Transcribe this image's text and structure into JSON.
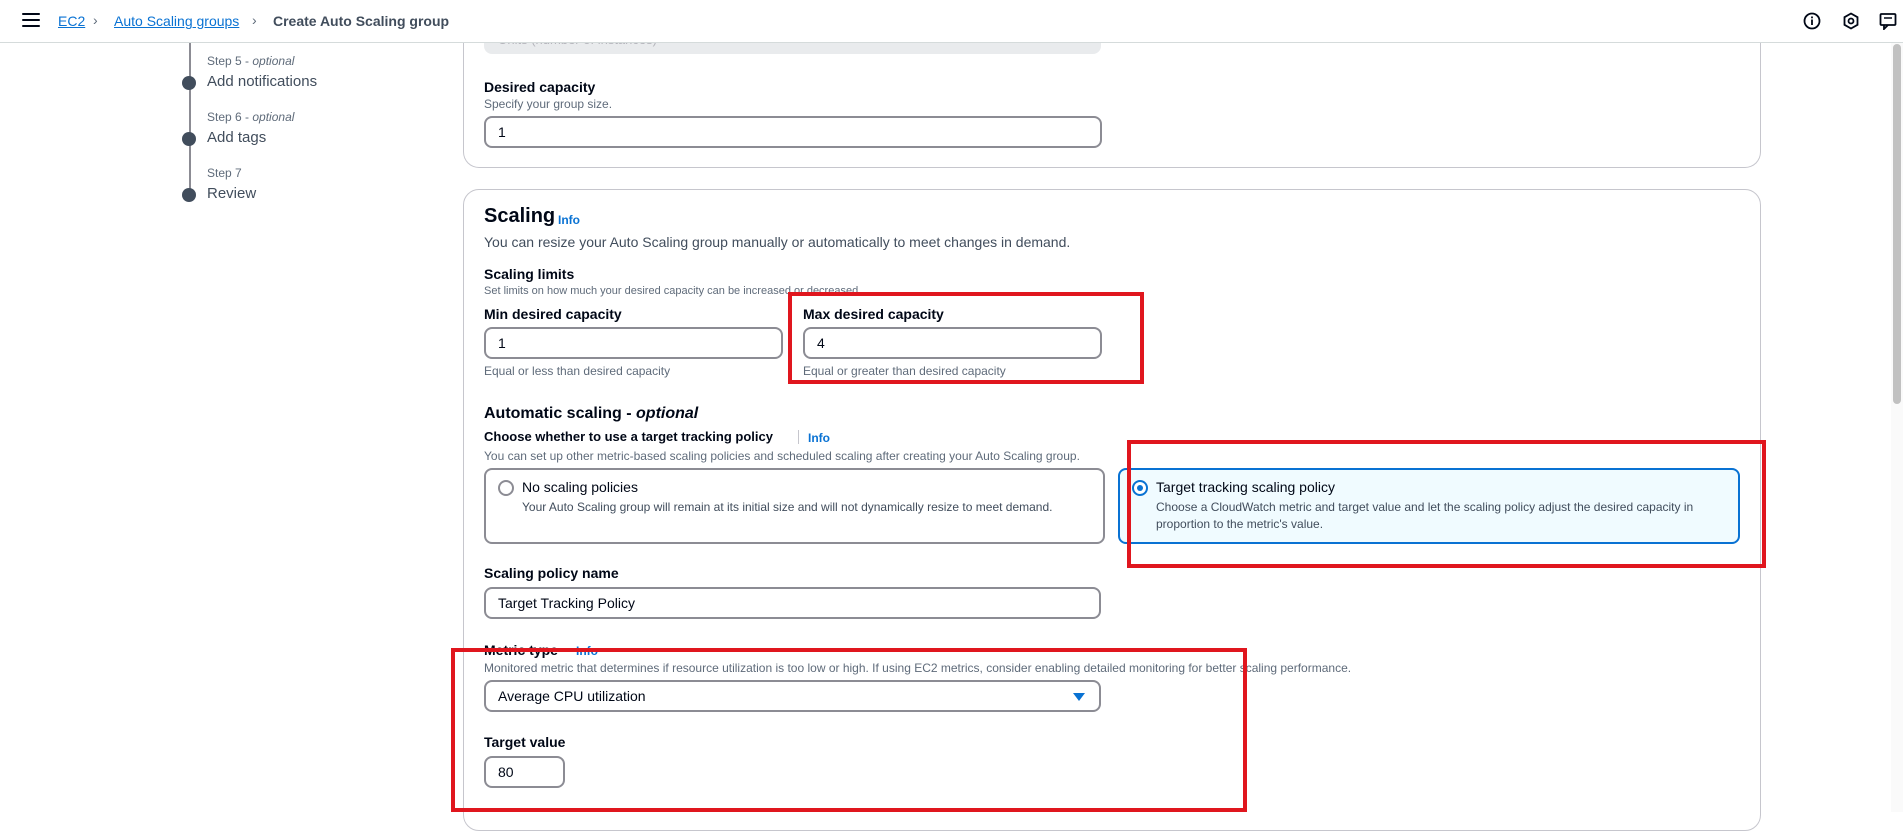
{
  "header": {
    "breadcrumbs": [
      "EC2",
      "Auto Scaling groups",
      "Create Auto Scaling group"
    ],
    "icons": [
      "menu-icon",
      "info-circle-icon",
      "settings-hex-icon",
      "feedback-icon"
    ]
  },
  "steps": [
    {
      "number": "Step 5",
      "suffix": "optional",
      "name": "Add notifications"
    },
    {
      "number": "Step 6",
      "suffix": "optional",
      "name": "Add tags"
    },
    {
      "number": "Step 7",
      "suffix": "",
      "name": "Review"
    }
  ],
  "capacity": {
    "disabled_placeholder": "Units (number of instances)",
    "desired_label": "Desired capacity",
    "desired_desc": "Specify your group size.",
    "desired_value": "1"
  },
  "scaling": {
    "title": "Scaling",
    "info": "Info",
    "desc": "You can resize your Auto Scaling group manually or automatically to meet changes in demand.",
    "limits_label": "Scaling limits",
    "limits_desc": "Set limits on how much your desired capacity can be increased or decreased.",
    "min_label": "Min desired capacity",
    "min_value": "1",
    "min_hint": "Equal or less than desired capacity",
    "max_label": "Max desired capacity",
    "max_value": "4",
    "max_hint": "Equal or greater than desired capacity"
  },
  "auto": {
    "title": "Automatic scaling - ",
    "title_optional": "optional",
    "choose_label": "Choose whether to use a target tracking policy",
    "info": "Info",
    "choose_desc": "You can set up other metric-based scaling policies and scheduled scaling after creating your Auto Scaling group.",
    "option_none_title": "No scaling policies",
    "option_none_desc": "Your Auto Scaling group will remain at its initial size and will not dynamically resize to meet demand.",
    "option_target_title": "Target tracking scaling policy",
    "option_target_desc": "Choose a CloudWatch metric and target value and let the scaling policy adjust the desired capacity in proportion to the metric's value.",
    "selected": "target"
  },
  "policy": {
    "name_label": "Scaling policy name",
    "name_value": "Target Tracking Policy",
    "metric_label": "Metric type",
    "metric_info": "Info",
    "metric_desc": "Monitored metric that determines if resource utilization is too low or high. If using EC2 metrics, consider enabling detailed monitoring for better scaling performance.",
    "metric_value": "Average CPU utilization",
    "target_label": "Target value",
    "target_value": "80"
  },
  "colors": {
    "accent": "#0972d3",
    "highlight": "#e0161e",
    "text": "#000716"
  }
}
